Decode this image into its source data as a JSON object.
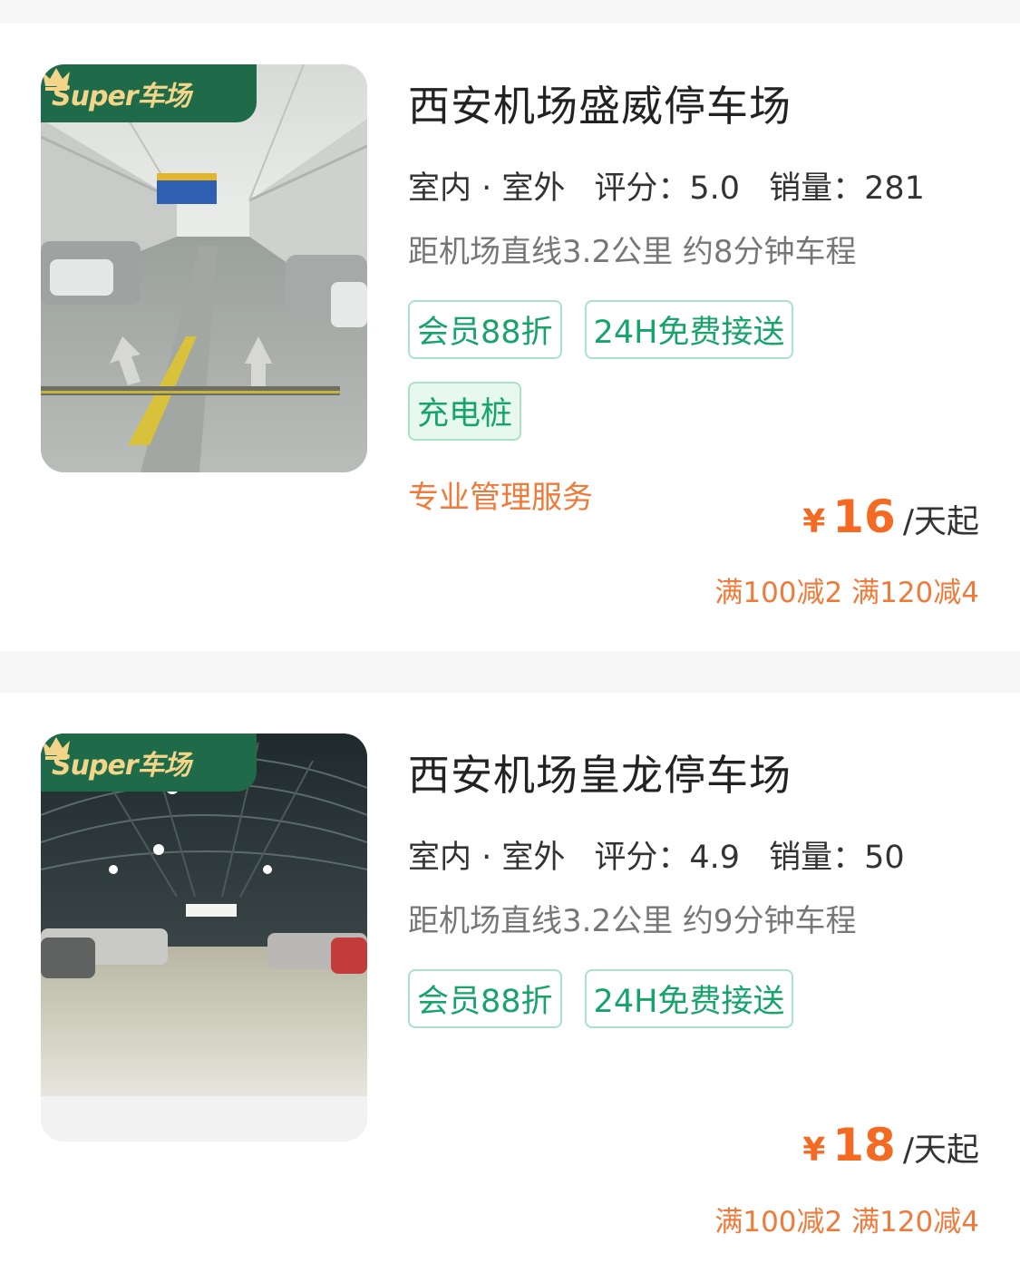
{
  "colors": {
    "accent_green": "#17a46b",
    "price_orange": "#f46a22",
    "promo_orange": "#f07a3a",
    "badge_green": "#1f6b49",
    "badge_gold": "#f3d58a"
  },
  "lots": [
    {
      "badge": "Super车场",
      "image": "indoor-parking-garage-photo",
      "name": "西安机场盛威停车场",
      "location_type": "室内 · 室外",
      "score_label": "评分：",
      "score": "5.0",
      "sales_label": "销量：",
      "sales": "281",
      "distance": "距机场直线3.2公里 约8分钟车程",
      "tags": [
        "会员88折",
        "24H免费接送",
        "充电桩"
      ],
      "service": "专业管理服务",
      "price_symbol": "¥",
      "price": "16",
      "price_unit": "/天起",
      "promo": "满100减2 满120减4"
    },
    {
      "badge": "Super车场",
      "image": "warehouse-parking-photo",
      "name": "西安机场皇龙停车场",
      "location_type": "室内 · 室外",
      "score_label": "评分：",
      "score": "4.9",
      "sales_label": "销量：",
      "sales": "50",
      "distance": "距机场直线3.2公里 约9分钟车程",
      "tags": [
        "会员88折",
        "24H免费接送"
      ],
      "price_symbol": "¥",
      "price": "18",
      "price_unit": "/天起",
      "promo": "满100减2 满120减4"
    }
  ]
}
